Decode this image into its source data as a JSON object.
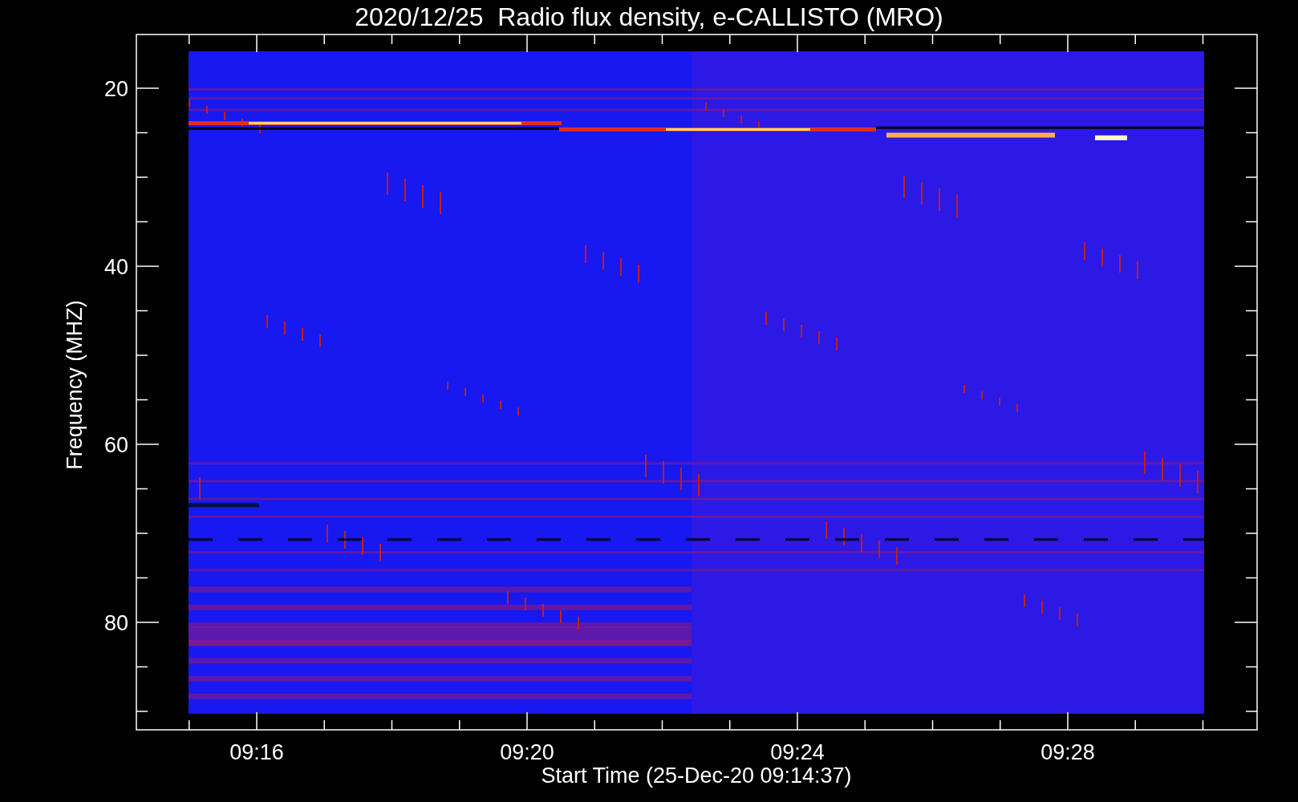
{
  "plot": {
    "title": "2020/12/25  Radio flux density, e-CALLISTO (MRO)",
    "y_axis": {
      "label": "Frequency (MHZ)",
      "tick_labels": [
        "20",
        "40",
        "60",
        "80"
      ]
    },
    "x_axis": {
      "label": "Start Time (25-Dec-20 09:14:37)",
      "tick_labels": [
        "09:16",
        "09:20",
        "09:24",
        "09:28"
      ]
    }
  }
}
